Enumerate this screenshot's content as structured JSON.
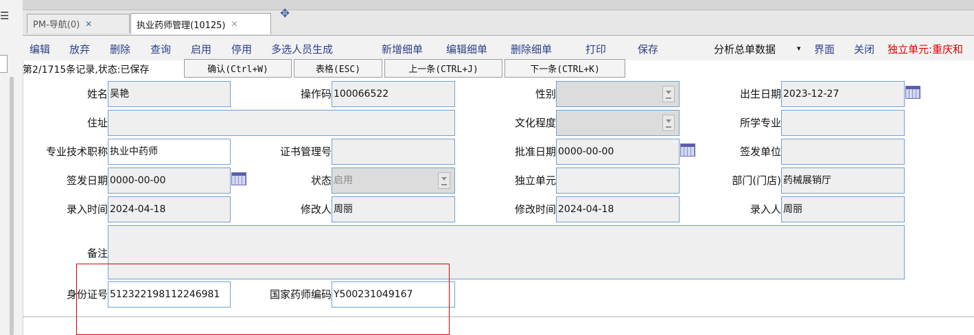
{
  "sidebar": {
    "menu_icon": "☰"
  },
  "tabs": [
    {
      "label": "PM-导航(0)",
      "close": "✕",
      "active": false
    },
    {
      "label": "执业药师管理(10125)",
      "close": "✕",
      "active": true
    }
  ],
  "tab_add_icon": "✥",
  "toolbar": {
    "edit": "编辑",
    "discard": "放弃",
    "delete": "删除",
    "query": "查询",
    "enable": "启用",
    "disable": "停用",
    "multi_generate": "多选人员生成",
    "add_detail": "新增细单",
    "edit_detail": "编辑细单",
    "delete_detail": "删除细单",
    "print": "打印",
    "save": "保存",
    "analyze": "分析总单数据",
    "analyze_caret": "▾",
    "ui": "界面",
    "close": "关闭",
    "unit": "独立单元:重庆和"
  },
  "status": {
    "text": "第2/1715条记录,状态:已保存",
    "confirm": "确认(Ctrl+W)",
    "table": "表格(ESC)",
    "prev": "上一条(CTRL+J)",
    "next": "下一条(CTRL+K)"
  },
  "form": {
    "name_label": "姓名",
    "name_value": "吴艳",
    "opcode_label": "操作码",
    "opcode_value": "100066522",
    "gender_label": "性别",
    "gender_value": "",
    "birth_label": "出生日期",
    "birth_value": "2023-12-27",
    "address_label": "住址",
    "address_value": "",
    "education_label": "文化程度",
    "education_value": "",
    "major_label": "所学专业",
    "major_value": "",
    "title_label": "专业技术职称",
    "title_value": "执业中药师",
    "certno_label": "证书管理号",
    "certno_value": "",
    "approve_label": "批准日期",
    "approve_value": "0000-00-00",
    "issuer_label": "签发单位",
    "issuer_value": "",
    "issue_date_label": "签发日期",
    "issue_date_value": "0000-00-00",
    "state_label": "状态",
    "state_value": "启用",
    "unit_label": "独立单元",
    "unit_value": "",
    "dept_label": "部门(门店)",
    "dept_value": "药械展销厅",
    "entry_time_label": "录入时间",
    "entry_time_value": "2024-04-18",
    "modifier_label": "修改人",
    "modifier_value": "周丽",
    "modify_time_label": "修改时间",
    "modify_time_value": "2024-04-18",
    "entry_person_label": "录入人",
    "entry_person_value": "周丽",
    "remark_label": "备注",
    "remark_value": "",
    "idcard_label": "身份证号",
    "idcard_value": "512322198112246981",
    "national_code_label": "国家药师编码",
    "national_code_value": "Y500231049167"
  },
  "icons": {
    "calendar": "calendar-icon",
    "dropdown": "dropdown-arrow-icon"
  },
  "colors": {
    "field_border": "#6f9fd6",
    "toolbar_text": "#2a3f88",
    "unit_text": "#e00000",
    "highlight": "#d60000"
  }
}
